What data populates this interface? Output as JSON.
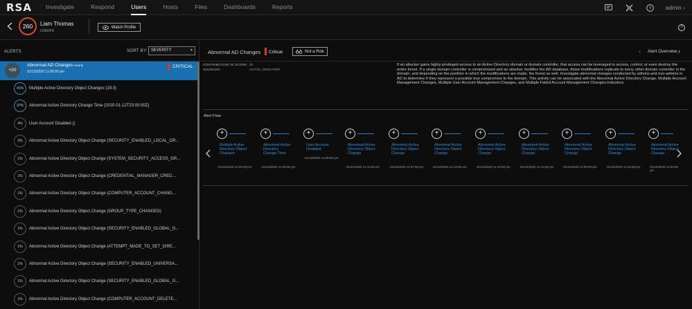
{
  "app": {
    "logo": "RSA",
    "nav": [
      "Investigate",
      "Respond",
      "Users",
      "Hosts",
      "Files",
      "Dashboards",
      "Reports"
    ],
    "active_nav": "Users",
    "admin_label": "admin"
  },
  "user": {
    "score": "260",
    "name": "Liam Thomas",
    "type": "USERS",
    "watch_label": "Watch Profile"
  },
  "alerts": {
    "title": "ALERTS",
    "sort_by_label": "SORT BY:",
    "sort_value": "SEVERITY",
    "selected": {
      "badge": "+20",
      "title": "Abnormal AD Changes",
      "frequency": "Hourly",
      "time": "01/12/2020 11:00:00 pm",
      "severity": "CRITICAL"
    },
    "items": [
      {
        "pct": "41%",
        "text": "Multiple Active Directory Object Changes (19.0)",
        "hi": true
      },
      {
        "pct": "37%",
        "text": "Abnormal Active Directory Change Time (2020-01-12T23:00:00Z)",
        "hi": true
      },
      {
        "pct": "4%",
        "text": "User Account Disabled ()",
        "hi": false
      },
      {
        "pct": "3%",
        "text": "Abnormal Active Directory Object Change (SECURITY_ENABLED_LOCAL_GR...",
        "hi": false
      },
      {
        "pct": "1%",
        "text": "Abnormal Active Directory Object Change (SYSTEM_SECURITY_ACCESS_GR...",
        "hi": false
      },
      {
        "pct": "1%",
        "text": "Abnormal Active Directory Object Change (CREDENTIAL_MANAGER_CRED...",
        "hi": false
      },
      {
        "pct": "1%",
        "text": "Abnormal Active Directory Object Change (COMPUTER_ACCOUNT_CHANG...",
        "hi": false
      },
      {
        "pct": "1%",
        "text": "Abnormal Active Directory Object Change (GROUP_TYPE_CHANGED)",
        "hi": false
      },
      {
        "pct": "1%",
        "text": "Abnormal Active Directory Object Change (SECURITY_ENABLED_GLOBAL_G...",
        "hi": false
      },
      {
        "pct": "1%",
        "text": "Abnormal Active Directory Object Change (ATTEMPT_MADE_TO_SET_DIRE...",
        "hi": false
      },
      {
        "pct": "1%",
        "text": "Abnormal Active Directory Object Change (SECURITY_ENABLED_UNIVERSA...",
        "hi": false
      },
      {
        "pct": "1%",
        "text": "Abnormal Active Directory Object Change (SECURITY_ENABLED_GLOBAL_G...",
        "hi": false
      },
      {
        "pct": "1%",
        "text": "Abnormal Active Directory Object Change (COMPUTER_ACCOUNT_DELETE...",
        "hi": false
      }
    ]
  },
  "indicator": {
    "title": "Abnormal AD Changes",
    "severity": "Critical",
    "not_a_risk_label": "Not a Risk",
    "alert_overview_label": "Alert Overview",
    "contribution_label": "CONTRIBUTION IN SCORE:",
    "contribution_value": "20",
    "sources_label": "SOURCES:",
    "sources_value": "ACTIVE_DIRECTORY",
    "description": "If an attacker gains highly privileged access to an Active Directory domain or domain controller, that access can be leveraged to access, control, or even destroy the entire forest. If a single domain controller is compromised and an attacker modifies the AD database, those modifications replicate to every other domain controller in the domain, and depending on the partition in which the modifications are made, the forest as well. Investigate abnormal changes conducted by admins and non-admins in AD to determine if they represent a possible true compromise to the domain. This activity can be associated with the Abnormal Active Directory Change, Multiple Account Management Changes, Multiple User Account Management Changes, and Multiple Failed Account Management Changes indicators.",
    "alert_flow_label": "Alert Flow",
    "flow": [
      {
        "name": "Multiple Active Directory Object Changes",
        "time": "01/12/2020 11:00:00 pm"
      },
      {
        "name": "Abnormal Active Directory Change Time",
        "time": "01/12/2020 11:00:00 pm"
      },
      {
        "name": "User Account Disabled",
        "time": "01/12/2020 11:05:00 pm"
      },
      {
        "name": "Abnormal Active Directory Object Change",
        "time": "01/12/2020 11:11:00 pm"
      },
      {
        "name": "Abnormal Active Directory Object Change",
        "time": "01/12/2020 11:07:00 pm"
      },
      {
        "name": "Abnormal Active Directory Object Change",
        "time": "01/12/2020 11:13:00 pm"
      },
      {
        "name": "Abnormal Active Directory Object Change",
        "time": "01/12/2020 11:10:00 pm"
      },
      {
        "name": "Abnormal Active Directory Object Change",
        "time": "01/12/2020 11:14:00 pm"
      },
      {
        "name": "Abnormal Active Directory Object Change",
        "time": "01/12/2020 11:00:00 pm"
      },
      {
        "name": "Abnormal Active Directory Object Change",
        "time": "01/12/2020 11:12:00 pm"
      },
      {
        "name": "Abnormal Active Directory Object Change",
        "time": "01/12/2020 11:03:00 pm"
      }
    ]
  }
}
